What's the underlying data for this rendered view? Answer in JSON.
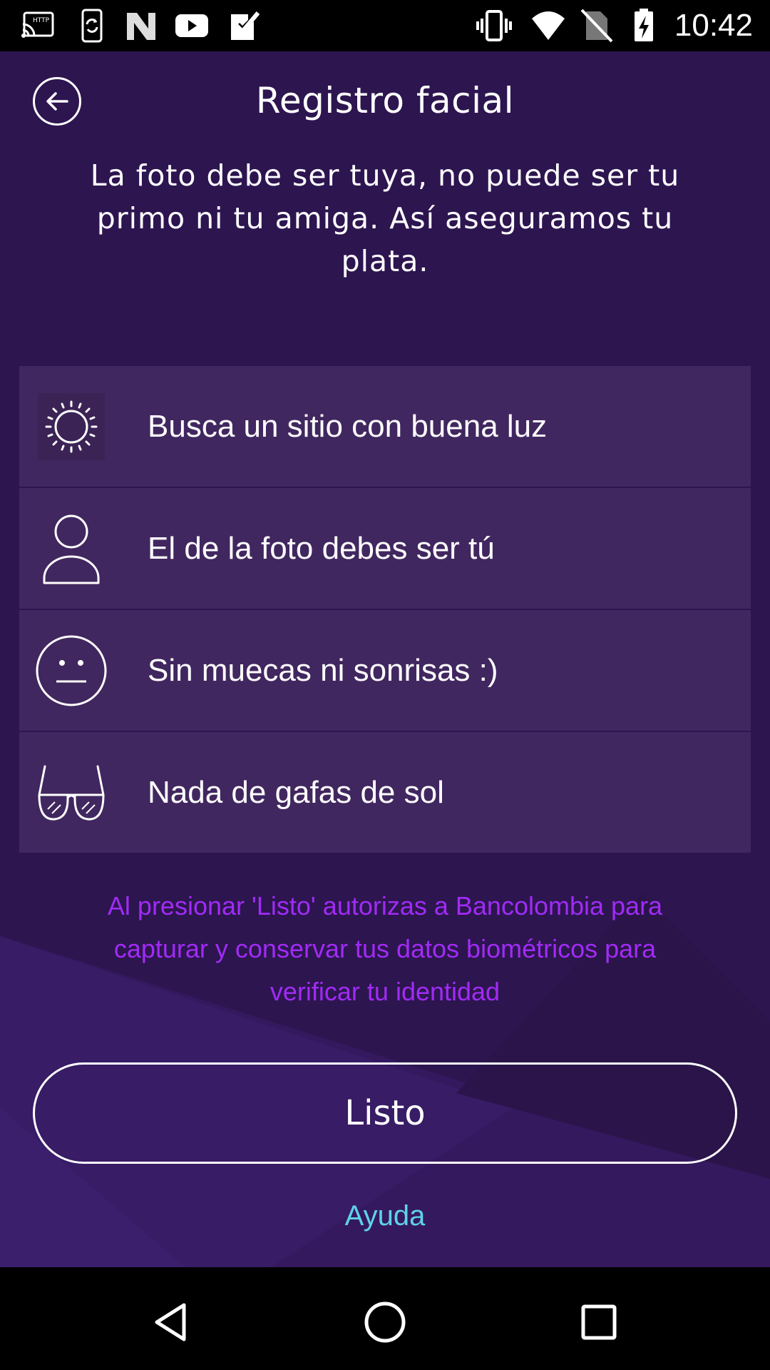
{
  "status_bar": {
    "time": "10:42",
    "icons": [
      "cast-icon",
      "sync-phone-icon",
      "n-icon",
      "youtube-icon",
      "task-check-icon",
      "vibrate-icon",
      "wifi-icon",
      "no-sim-icon",
      "battery-charging-icon"
    ]
  },
  "header": {
    "title": "Registro facial",
    "back_icon": "back-arrow-icon"
  },
  "subtitle": "La foto debe ser tuya, no puede ser tu primo ni tu amiga. Así aseguramos tu plata.",
  "tips": [
    {
      "icon": "sun-icon",
      "label": "Busca un sitio con buena luz"
    },
    {
      "icon": "person-icon",
      "label": "El de la foto debes ser tú"
    },
    {
      "icon": "neutral-face-icon",
      "label": "Sin muecas ni sonrisas :)"
    },
    {
      "icon": "sunglasses-icon",
      "label": "Nada de gafas de sol"
    }
  ],
  "consent_text": "Al presionar 'Listo' autorizas a Bancolombia para capturar y conservar tus datos biométricos para verificar tu identidad",
  "primary_button": {
    "label": "Listo"
  },
  "help_link": {
    "label": "Ayuda"
  },
  "navigation": [
    "back-triangle-icon",
    "home-circle-icon",
    "recents-square-icon"
  ],
  "colors": {
    "background": "#2d1550",
    "tip_row": "#41275f",
    "consent_text": "#a12bf5",
    "help_link": "#5ed3e8"
  }
}
